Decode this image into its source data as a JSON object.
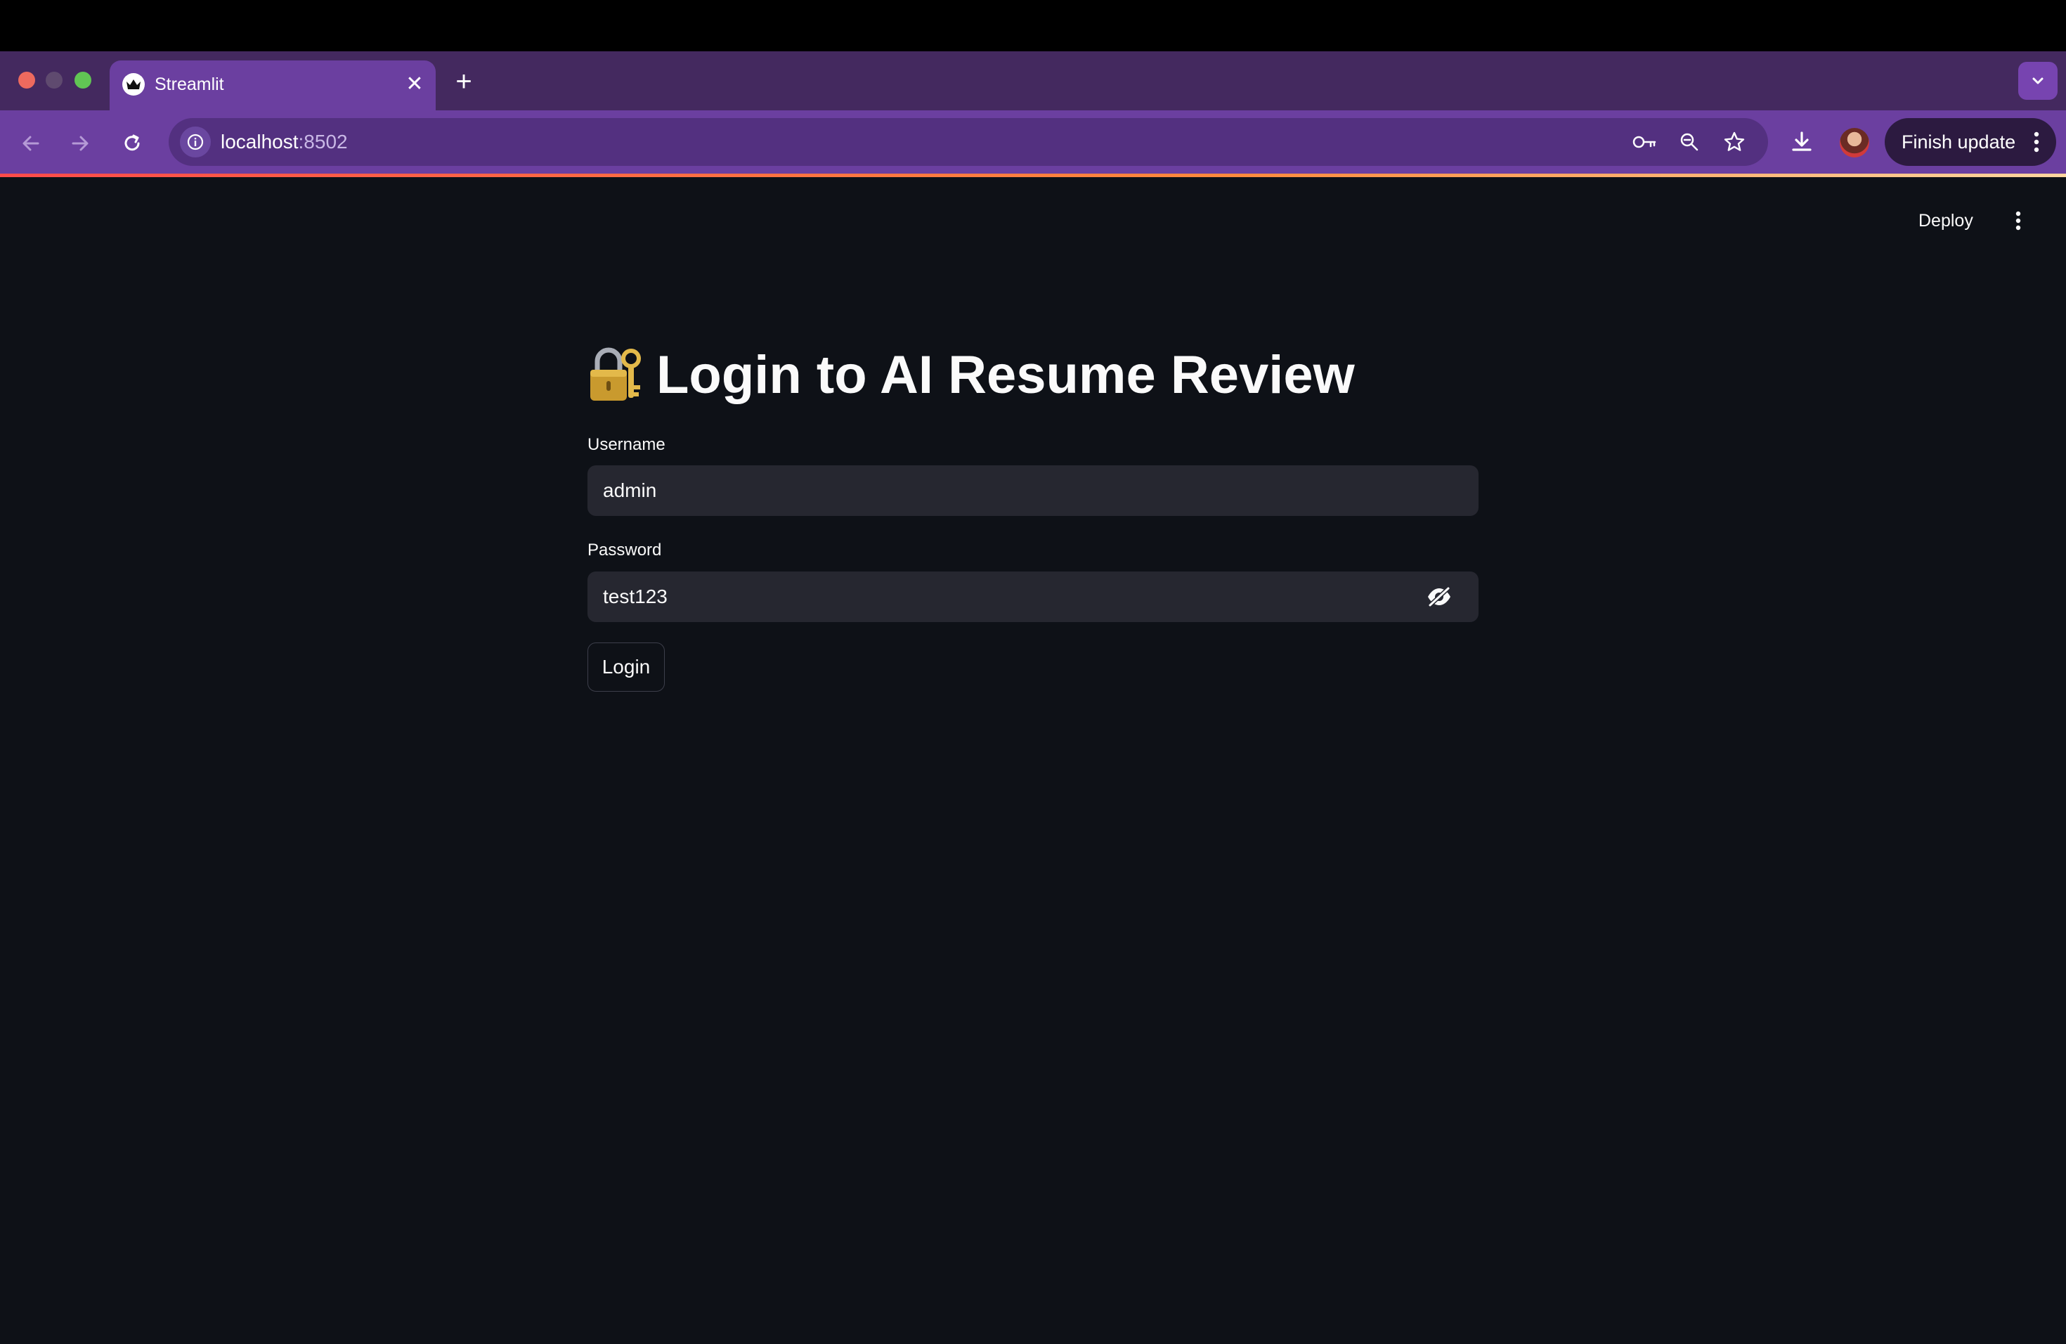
{
  "browser": {
    "tab_title": "Streamlit",
    "new_tab_symbol": "+",
    "close_symbol": "✕",
    "url_host": "localhost",
    "url_port": ":8502",
    "update_button_label": "Finish update",
    "icons": {
      "favicon": "streamlit-crown-icon",
      "back": "back-arrow-icon",
      "forward": "forward-arrow-icon",
      "reload": "reload-icon",
      "site_info": "info-icon",
      "passwords": "key-icon",
      "zoom": "zoom-out-icon",
      "bookmark": "star-icon",
      "downloads": "download-icon",
      "menu": "more-vert-icon"
    },
    "colors": {
      "tabstrip": "#44295f",
      "toolbar": "#6b3fa0",
      "omnibox": "#533080"
    }
  },
  "app": {
    "deploy_label": "Deploy",
    "title_icon": "lock-with-key-icon",
    "title": "Login to AI Resume Review",
    "username": {
      "label": "Username",
      "value": "admin"
    },
    "password": {
      "label": "Password",
      "value": "test123",
      "toggle_icon": "eye-slash-icon"
    },
    "login_button_label": "Login",
    "colors": {
      "background": "#0e1117",
      "input_background": "#262730",
      "text": "#fafafa"
    }
  }
}
